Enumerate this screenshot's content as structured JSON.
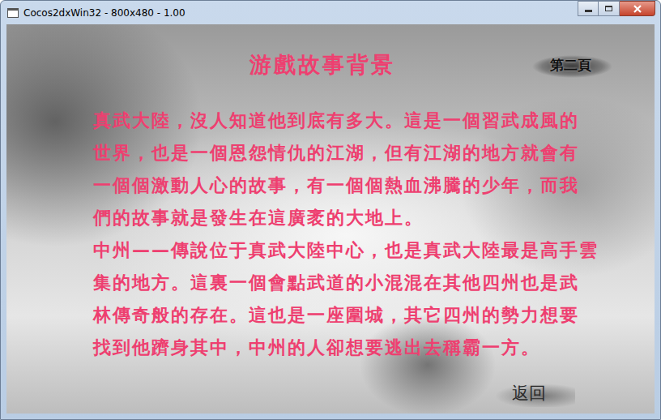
{
  "window": {
    "title": "Cocos2dxWin32 - 800x480 - 1.00"
  },
  "heading": "游戲故事背景",
  "page_label": "第二頁",
  "story_lines": [
    "真武大陸，沒人知道他到底有多大。這是一個習武成風的",
    "世界，也是一個恩怨情仇的江湖，但有江湖的地方就會有",
    "一個個激動人心的故事，有一個個熱血沸騰的少年，而我",
    "們的故事就是發生在這廣袤的大地上。",
    "中州——傳說位于真武大陸中心，也是真武大陸最是高手雲",
    "集的地方。這裏一個會點武道的小混混在其他四州也是武",
    "林傳奇般的存在。這也是一座圍城，其它四州的勢力想要",
    "找到他躋身其中，中州的人卻想要逃出去稱霸一方。"
  ],
  "back_button": "返回"
}
